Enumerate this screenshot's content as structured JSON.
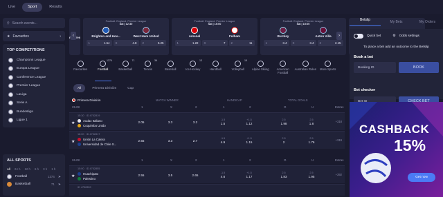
{
  "topbar": {
    "tabs": [
      "Live",
      "Sport",
      "Results"
    ]
  },
  "left": {
    "search_placeholder": "Search events...",
    "favourites": "Favourites",
    "top_title": "TOP COMPETITIONS",
    "competitions": [
      "Champions League",
      "Europa League",
      "Conference League",
      "Premier League",
      "LaLiga",
      "Serie A",
      "Bundesliga",
      "Ligue 1"
    ],
    "all_sports_title": "ALL SPORTS",
    "time_filters": [
      "All",
      "24 h",
      "12 h",
      "6 h",
      "3 h",
      "1 h"
    ],
    "sports": [
      {
        "name": "Football",
        "count": "1374"
      },
      {
        "name": "Basketball",
        "count": "71"
      }
    ]
  },
  "cards": [
    {
      "league": "Football. England. Premier League",
      "date": "Sat | 12:30",
      "home": "Brighton and Hov...",
      "away": "West Ham United",
      "odds": [
        {
          "k": "1",
          "v": "1.54"
        },
        {
          "k": "X",
          "v": "4.8"
        },
        {
          "k": "2",
          "v": "5.25"
        }
      ]
    },
    {
      "league": "Football. England. Premier League",
      "date": "Sat | 15:00",
      "home": "Arsenal",
      "away": "Fulham",
      "odds": [
        {
          "k": "1",
          "v": "1.22"
        },
        {
          "k": "X",
          "v": "7"
        },
        {
          "k": "2",
          "v": "11"
        }
      ]
    },
    {
      "league": "Football. England. Premier League",
      "date": "Sat | 15:00",
      "home": "Burnley",
      "away": "Aston Villa",
      "odds": [
        {
          "k": "1",
          "v": "3.4"
        },
        {
          "k": "X",
          "v": "3.4"
        },
        {
          "k": "2",
          "v": "2.15"
        }
      ]
    }
  ],
  "partial_left_team": "n Forest",
  "partial_right_team": "Sheffie",
  "sports_bar": [
    {
      "label": "Favourites",
      "badge": ""
    },
    {
      "label": "Football",
      "badge": "1374"
    },
    {
      "label": "Basketball",
      "badge": "71"
    },
    {
      "label": "Tennis",
      "badge": "36"
    },
    {
      "label": "Baseball",
      "badge": ""
    },
    {
      "label": "Ice Hockey",
      "badge": "13"
    },
    {
      "label": "Handball",
      "badge": ""
    },
    {
      "label": "Volleyball",
      "badge": "15"
    },
    {
      "label": "Alpine Skiing",
      "badge": ""
    },
    {
      "label": "American Football",
      "badge": ""
    },
    {
      "label": "Australian Rules",
      "badge": ""
    },
    {
      "label": "More Sports",
      "badge": ""
    }
  ],
  "subtabs": [
    "All",
    "Primera División",
    "Cup"
  ],
  "table_header": {
    "match_winner": "MATCH WINNER",
    "handicap": "HANDICAP",
    "total_goals": "TOTAL GOALS"
  },
  "league_name": "Primera División",
  "col_heads": {
    "date1": "25.08",
    "date2": "26.08",
    "c1": "1",
    "cx": "X",
    "c2": "2",
    "h1": "1",
    "h2": "2",
    "o": "O",
    "u": "U",
    "extra": "Extras"
  },
  "matches": [
    {
      "time": "15:30",
      "id": "ID 4752819",
      "home": "Audax Italiano",
      "away": "Coquimbo Unido",
      "w1": "2.05",
      "wx": "3.3",
      "w2": "3.2",
      "h1": "1.5",
      "h1l": "-1.5",
      "h2": "1.12",
      "h2l": "+1.5",
      "o": "1.98",
      "ol": "2.5",
      "u": "1.8",
      "ul": "2.5",
      "more": "+318"
    },
    {
      "time": "18:00",
      "id": "ID 4752817",
      "home": "Unión La Calera",
      "away": "Universidad de Chile S...",
      "w1": "2.55",
      "wx": "3.3",
      "w2": "2.7",
      "h1": "4.9",
      "h1l": "-1.5",
      "h2": "1.15",
      "h2l": "+1.5",
      "o": "2",
      "ol": "2.5",
      "u": "1.76",
      "ul": "2.5",
      "more": "+319"
    },
    {
      "time": "15:00",
      "id": "ID 4752855",
      "home": "Huachipato",
      "away": "Palestino",
      "w1": "2.55",
      "wx": "3.5",
      "w2": "2.65",
      "h1": "4.6",
      "h1l": "-1.5",
      "h2": "1.17",
      "h2l": "+1.5",
      "o": "1.83",
      "ol": "2.5",
      "u": "1.95",
      "ul": "2.5",
      "more": "+392"
    },
    {
      "time": "",
      "id": "ID 4752859",
      "home": "",
      "away": "",
      "w1": "",
      "wx": "",
      "w2": "",
      "h1": "",
      "h1l": "",
      "h2": "",
      "h2l": "",
      "o": "",
      "ol": "",
      "u": "",
      "ul": "",
      "more": ""
    }
  ],
  "right": {
    "tabs": [
      "Betslip",
      "My Bets",
      "My Orders"
    ],
    "quick_bet": "Quick bet",
    "odds_settings": "Odds settings",
    "hint": "To place a bet add an outcome to the Betslip",
    "book_title": "Book a bet",
    "booking_placeholder": "Booking ID",
    "book_button": "BOOK",
    "checker_title": "Bet checker",
    "bet_id_placeholder": "Bet ID",
    "check_button": "CHECK BET",
    "promo_title": "CASHBACK",
    "promo_pct": "15%",
    "promo_button": "Get now"
  }
}
